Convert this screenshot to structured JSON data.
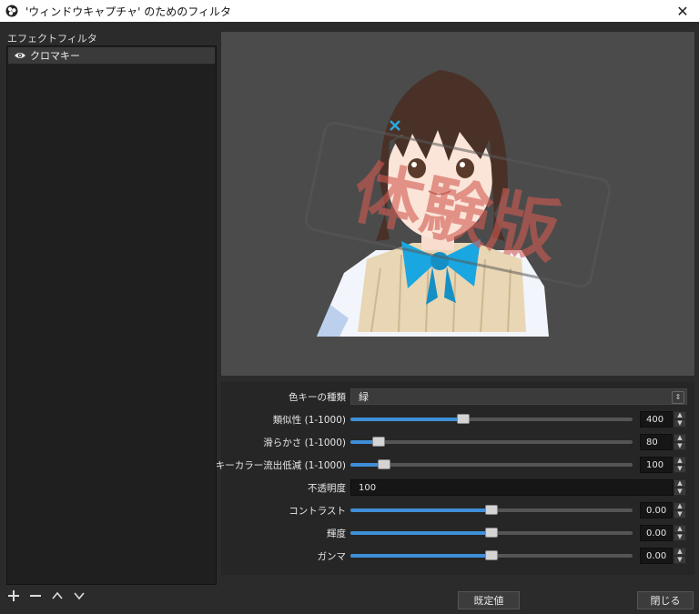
{
  "window": {
    "title": "'ウィンドウキャプチャ' のためのフィルタ",
    "close": "✕"
  },
  "filters": {
    "section_label": "エフェクトフィルタ",
    "items": [
      {
        "label": "クロマキー"
      }
    ]
  },
  "preview": {
    "watermark": "体験版"
  },
  "properties": {
    "key_type": {
      "label": "色キーの種類",
      "value": "緑"
    },
    "similarity": {
      "label": "類似性 (1-1000)",
      "value": "400",
      "fraction": 0.4
    },
    "smoothness": {
      "label": "滑らかさ (1-1000)",
      "value": "80",
      "fraction": 0.1
    },
    "spill": {
      "label": "キーカラー流出低減 (1-1000)",
      "value": "100",
      "fraction": 0.12
    },
    "opacity": {
      "label": "不透明度",
      "value": "100"
    },
    "contrast": {
      "label": "コントラスト",
      "value": "0.00",
      "fraction": 0.5
    },
    "brightness": {
      "label": "輝度",
      "value": "0.00",
      "fraction": 0.5
    },
    "gamma": {
      "label": "ガンマ",
      "value": "0.00",
      "fraction": 0.5
    }
  },
  "buttons": {
    "defaults": "既定値",
    "close": "閉じる"
  },
  "toolbar_icons": [
    "add-icon",
    "remove-icon",
    "move-up-icon",
    "move-down-icon"
  ],
  "colors": {
    "accent": "#3f8fd8",
    "background": "#2b2b2b",
    "preview_bg": "#4b4b4b"
  }
}
